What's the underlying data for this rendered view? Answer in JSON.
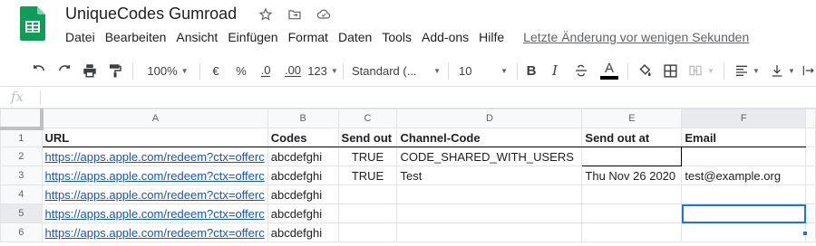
{
  "app": {
    "title": "UniqueCodes Gumroad",
    "menu": [
      "Datei",
      "Bearbeiten",
      "Ansicht",
      "Einfügen",
      "Format",
      "Daten",
      "Tools",
      "Add-ons",
      "Hilfe"
    ],
    "last_edit": "Letzte Änderung vor wenigen Sekunden"
  },
  "toolbar": {
    "zoom": "100%",
    "currency": "€",
    "percent": "%",
    "dec_decrease": ".0",
    "dec_increase": ".00",
    "more_formats": "123",
    "font": "Standard (...",
    "font_size": "10",
    "bold": "B",
    "italic": "I",
    "text_color": "A"
  },
  "formula_bar": {
    "fx": "fx",
    "value": ""
  },
  "columns": [
    "A",
    "B",
    "C",
    "D",
    "E",
    "F"
  ],
  "rows": [
    {
      "num": "1",
      "cells": [
        "URL",
        "Codes",
        "Send out",
        "Channel-Code",
        "Send out at",
        "Email"
      ]
    },
    {
      "num": "2",
      "cells": [
        "https://apps.apple.com/redeem?ctx=offerc",
        "abcdefghi",
        "TRUE",
        "CODE_SHARED_WITH_USERS",
        "",
        ""
      ]
    },
    {
      "num": "3",
      "cells": [
        "https://apps.apple.com/redeem?ctx=offerc",
        "abcdefghi",
        "TRUE",
        "Test",
        "Thu Nov 26 2020",
        "test@example.org"
      ]
    },
    {
      "num": "4",
      "cells": [
        "https://apps.apple.com/redeem?ctx=offerc",
        "abcdefghi",
        "",
        "",
        "",
        ""
      ]
    },
    {
      "num": "5",
      "cells": [
        "https://apps.apple.com/redeem?ctx=offerc",
        "abcdefghi",
        "",
        "",
        "",
        ""
      ]
    },
    {
      "num": "6",
      "cells": [
        "https://apps.apple.com/redeem?ctx=offerc",
        "abcdefghi",
        "",
        "",
        "",
        ""
      ]
    }
  ],
  "colors": {
    "link": "#1155cc",
    "selection": "#1a73e8",
    "sheets_green": "#0f9d58"
  }
}
